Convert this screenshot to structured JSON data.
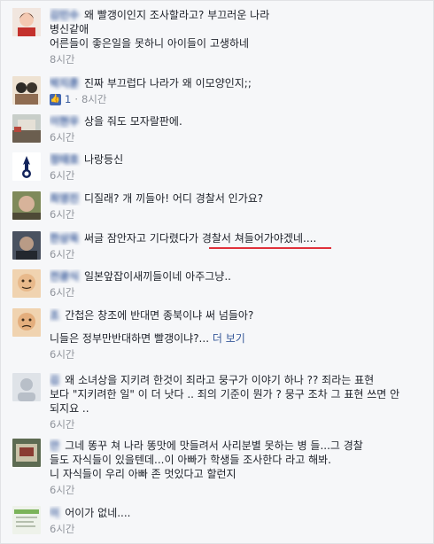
{
  "comments": [
    {
      "author": "김민수",
      "text_lines": [
        "왜 빨갱이인지 조사할라고? 부끄러운 나라",
        "병신같애",
        "어른들이 좋은일을 못하니 아이들이 고생하네"
      ],
      "time": "8시간"
    },
    {
      "author": "박지훈",
      "text_lines": [
        "진짜 부끄럽다 나라가 왜 이모양인지;;"
      ],
      "likes": "1",
      "time": "8시간"
    },
    {
      "author": "이현우",
      "text_lines": [
        "상을 줘도 모자랄판에."
      ],
      "time": "6시간"
    },
    {
      "author": "정태호",
      "text_lines": [
        "나랑등신"
      ],
      "time": "6시간"
    },
    {
      "author": "최영진",
      "text_lines": [
        "디질래? 개   끼들아! 어디 경찰서 인가요?"
      ],
      "time": "6시간"
    },
    {
      "author": "한상욱",
      "text_lines": [
        "써글 잠안자고 기다렸다가 경찰서 쳐들어가야겠네...."
      ],
      "time": "6시간"
    },
    {
      "author": "전광식",
      "text_lines": [
        "일본앞잡이새끼들이네 아주그냥.."
      ],
      "time": "6시간"
    },
    {
      "author": "조  ",
      "text_lines": [
        "간첩은 창조에 반대면 종북이냐 써 넘들아?",
        "니들은 정부만반대하면 빨갱이냐?..."
      ],
      "more": "더 보기",
      "time": "6시간"
    },
    {
      "author": "김  ",
      "text_lines": [
        "왜 소녀상을 지키려 한것이 죄라고 뭉구가 이야기 하나 ?? 죄라는 표현",
        "보다 \"지키려한 일\" 이 더 낫다 .. 죄의 기준이 뭔가 ? 뭉구 조차 그 표현 쓰면 안",
        "되지요 .."
      ],
      "time": "6시간"
    },
    {
      "author": "안  ",
      "text_lines": [
        "그네 똥꾸 쳐 나라 똥맛에 맛들려서 사리분별 못하는 병  들...그 경찰",
        "들도 자식들이 있을텐데...이 아빠가 학생들 조사한다 라고 해봐.",
        "니 자식들이 우리 아빠 존  멋있다고 할런지"
      ],
      "time": "6시간"
    },
    {
      "author": "이  ",
      "text_lines": [
        "어이가 없네...."
      ],
      "time": "6시간"
    }
  ]
}
